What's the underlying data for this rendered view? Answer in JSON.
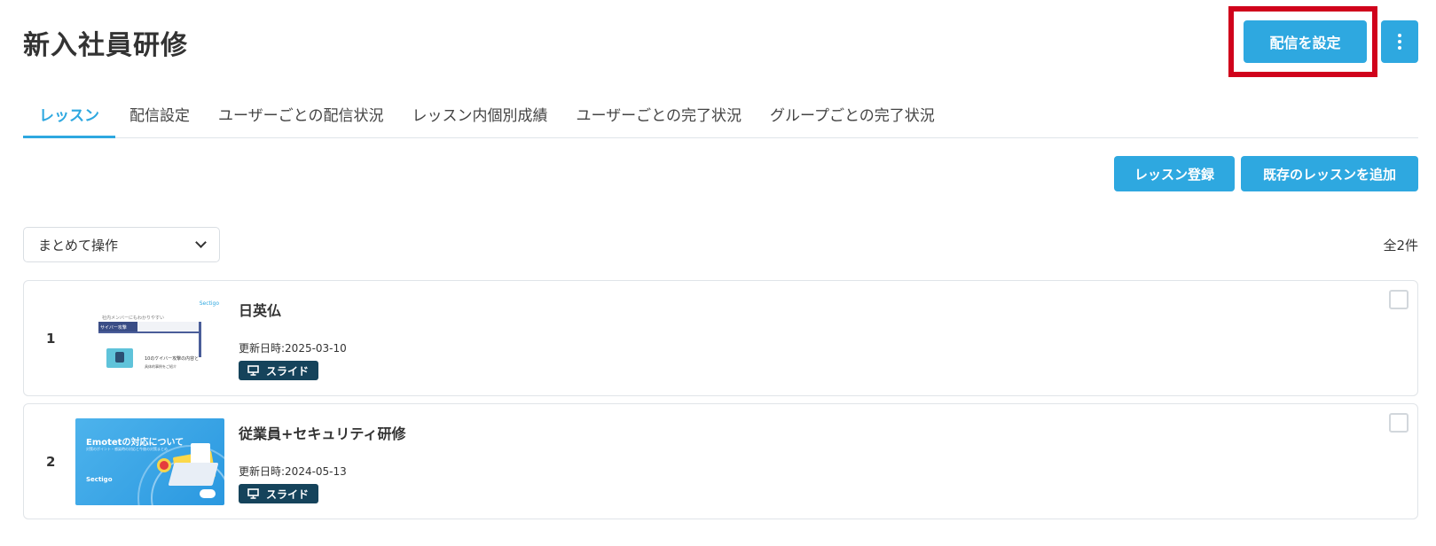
{
  "page": {
    "title": "新入社員研修"
  },
  "header": {
    "deliver_button": "配信を設定",
    "more_button_icon": "kebab-vertical-icon"
  },
  "tabs": [
    {
      "label": "レッスン",
      "active": true
    },
    {
      "label": "配信設定",
      "active": false
    },
    {
      "label": "ユーザーごとの配信状況",
      "active": false
    },
    {
      "label": "レッスン内個別成績",
      "active": false
    },
    {
      "label": "ユーザーごとの完了状況",
      "active": false
    },
    {
      "label": "グループごとの完了状況",
      "active": false
    }
  ],
  "actions": {
    "register_lesson": "レッスン登録",
    "add_existing_lesson": "既存のレッスンを追加"
  },
  "bulk": {
    "label": "まとめて操作"
  },
  "total": "全2件",
  "lessons": [
    {
      "index": "1",
      "title": "日英仏",
      "updated": "更新日時:2025-03-10",
      "type": "スライド"
    },
    {
      "index": "2",
      "title": "従業員+セキュリティ研修",
      "updated": "更新日時:2024-05-13",
      "type": "スライド"
    }
  ],
  "thumbnails": {
    "t1": {
      "logo": "Sectigo",
      "line1": "社内メンバーにもわかりやすい",
      "bar": "サイバー攻撃",
      "txt2": "10のケイバー攻撃の内容と",
      "txt3": "具体的事例をご紹介"
    },
    "t2": {
      "head": "Emotetの対応について",
      "sub": "対策のポイント・感染時の対応と今後の対策まとめ",
      "brand": "Sectigo"
    }
  },
  "colors": {
    "accent": "#2ea8e0",
    "badge": "#15435b",
    "highlight": "#d0021b"
  }
}
